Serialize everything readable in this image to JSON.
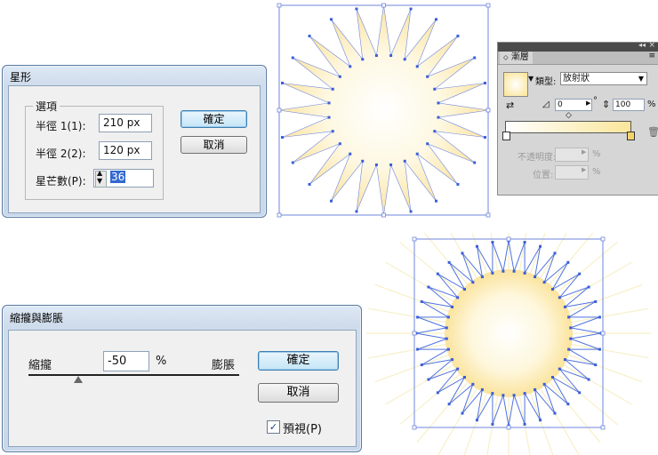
{
  "star_dialog": {
    "title": "星形",
    "group_label": "選項",
    "radius1_label": "半徑 1(1):",
    "radius1_value": "210 px",
    "radius2_label": "半徑 2(2):",
    "radius2_value": "120 px",
    "points_label": "星芒數(P):",
    "points_value": "36",
    "ok_label": "確定",
    "cancel_label": "取消"
  },
  "gradient_panel": {
    "tab_label": "漸層",
    "type_label": "類型:",
    "type_value": "放射狀",
    "angle_value": "0",
    "degree_symbol": "°",
    "ratio_value": "100",
    "percent_symbol": "%",
    "opacity_label": "不透明度:",
    "location_label": "位置:",
    "opacity_percent": "%",
    "location_percent": "%",
    "colors": {
      "start": "#ffffff",
      "end": "#fbe69b"
    }
  },
  "pucker_dialog": {
    "title": "縮攏與膨脹",
    "pucker_label": "縮攏",
    "bloat_label": "膨脹",
    "value": "-50",
    "percent": "%",
    "ok_label": "確定",
    "cancel_label": "取消",
    "preview_label": "預視(P)",
    "preview_checked": true
  },
  "colors": {
    "star_fill": "#fbe4a0",
    "anchor": "#3a5ed8",
    "bbox": "#6f86dd",
    "outline": "#5072e0"
  }
}
